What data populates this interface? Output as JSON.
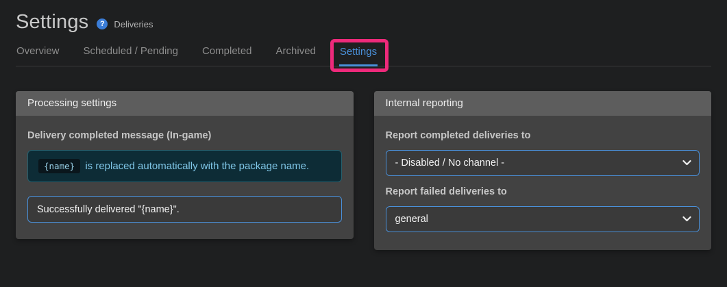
{
  "page": {
    "title": "Settings",
    "subtitle": "Deliveries",
    "help_icon": "question-mark-circle-icon"
  },
  "tabs": {
    "items": [
      {
        "label": "Overview",
        "active": false
      },
      {
        "label": "Scheduled / Pending",
        "active": false
      },
      {
        "label": "Completed",
        "active": false
      },
      {
        "label": "Archived",
        "active": false
      },
      {
        "label": "Settings",
        "active": true,
        "highlighted": true
      }
    ]
  },
  "panels": {
    "processing": {
      "title": "Processing settings",
      "message_label": "Delivery completed message (In-game)",
      "info_code": "{name}",
      "info_text": "is replaced automatically with the package name.",
      "message_value": "Successfully delivered \"{name}\"."
    },
    "reporting": {
      "title": "Internal reporting",
      "completed_label": "Report completed deliveries to",
      "completed_selected": "- Disabled / No channel -",
      "failed_label": "Report failed deliveries to",
      "failed_selected": "general"
    }
  },
  "colors": {
    "accent_blue": "#4a90d9",
    "highlight_pink": "#ee2a7b",
    "panel_header_bg": "#5d5d5d",
    "panel_body_bg": "#424242",
    "info_box_bg": "#0d2c36",
    "info_text": "#80c7e8",
    "page_bg": "#1e1f20"
  }
}
